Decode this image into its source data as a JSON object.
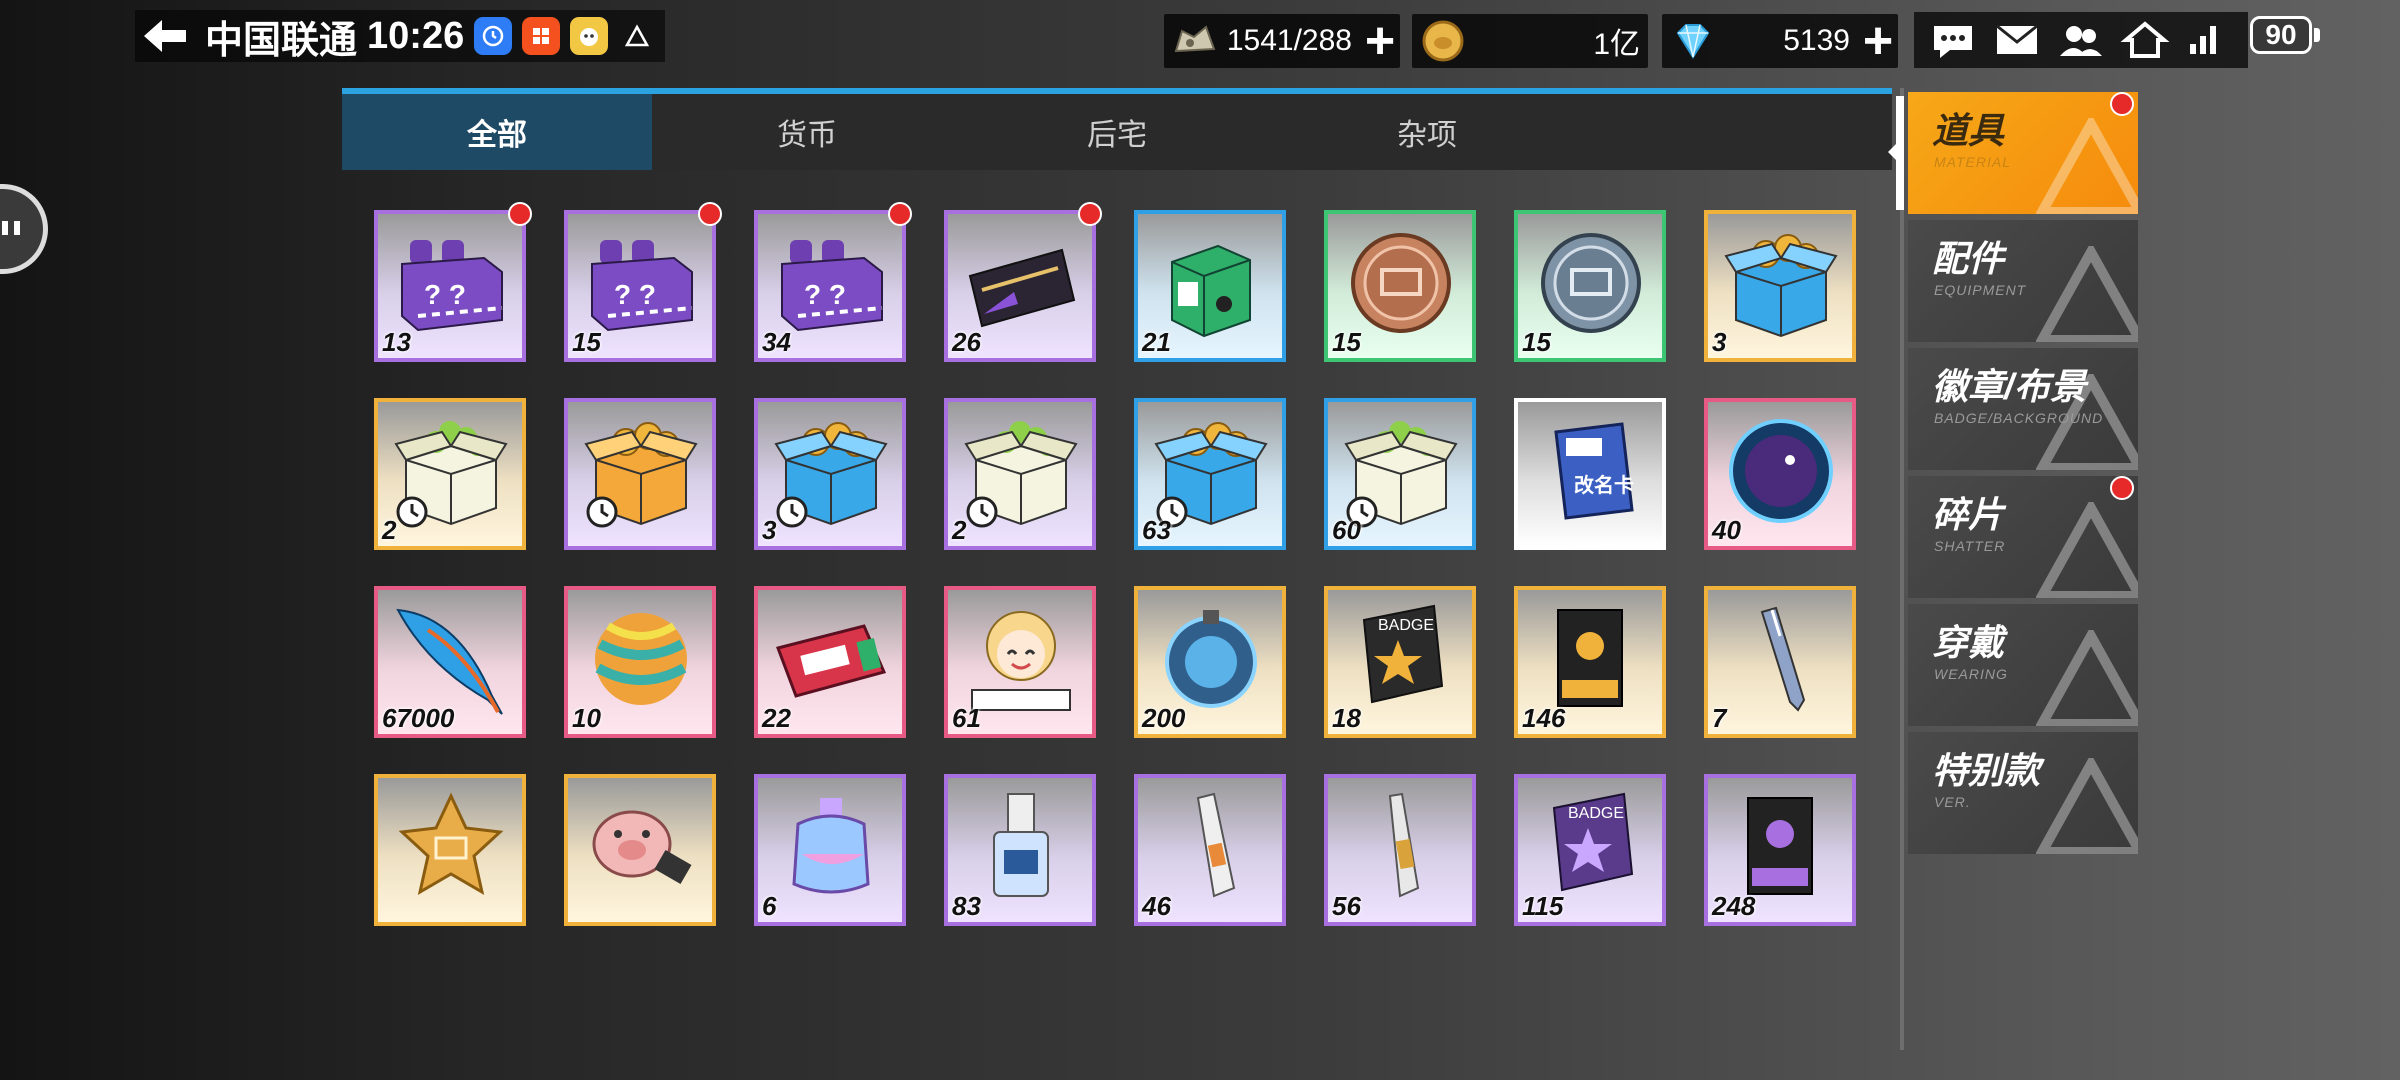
{
  "status_bar": {
    "carrier": "中国联通",
    "time": "10:26",
    "battery": "90"
  },
  "resources": {
    "stamina": "1541/288",
    "coins": "1亿",
    "gems": "5139"
  },
  "tabs": [
    {
      "label": "全部",
      "active": true
    },
    {
      "label": "货币",
      "active": false
    },
    {
      "label": "后宅",
      "active": false
    },
    {
      "label": "杂项",
      "active": false
    }
  ],
  "items": [
    {
      "count": "13",
      "rarity": "purple",
      "art": "gift-box-icon",
      "dot": true
    },
    {
      "count": "15",
      "rarity": "purple",
      "art": "gift-box-icon",
      "dot": true
    },
    {
      "count": "34",
      "rarity": "purple",
      "art": "gift-box-icon",
      "dot": true
    },
    {
      "count": "26",
      "rarity": "purple",
      "art": "ticket-icon",
      "dot": true
    },
    {
      "count": "21",
      "rarity": "blue",
      "art": "green-box-icon",
      "dot": false
    },
    {
      "count": "15",
      "rarity": "green",
      "art": "bronze-coin-icon",
      "dot": false
    },
    {
      "count": "15",
      "rarity": "green",
      "art": "silver-coin-icon",
      "dot": false
    },
    {
      "count": "3",
      "rarity": "gold",
      "art": "coin-chest-blue-icon",
      "dot": false
    },
    {
      "count": "2",
      "rarity": "gold",
      "art": "timed-clover-box-icon",
      "dot": false
    },
    {
      "count": "",
      "rarity": "purple",
      "art": "timed-coin-box-icon",
      "dot": false
    },
    {
      "count": "3",
      "rarity": "purple",
      "art": "timed-blue-box-icon",
      "dot": false
    },
    {
      "count": "2",
      "rarity": "purple",
      "art": "timed-clover-box-icon",
      "dot": false
    },
    {
      "count": "63",
      "rarity": "blue",
      "art": "timed-blue-box-icon",
      "dot": false
    },
    {
      "count": "60",
      "rarity": "blue",
      "art": "timed-clover-box-icon",
      "dot": false
    },
    {
      "count": "",
      "rarity": "white",
      "art": "rename-card-icon",
      "dot": false
    },
    {
      "count": "40",
      "rarity": "pink",
      "art": "moon-orb-icon",
      "dot": false
    },
    {
      "count": "67000",
      "rarity": "pink",
      "art": "feather-icon",
      "dot": false
    },
    {
      "count": "10",
      "rarity": "pink",
      "art": "striped-ball-icon",
      "dot": false
    },
    {
      "count": "22",
      "rarity": "pink",
      "art": "lucky-ticket-icon",
      "dot": false
    },
    {
      "count": "61",
      "rarity": "pink",
      "art": "figure-story-icon",
      "dot": false
    },
    {
      "count": "200",
      "rarity": "gold",
      "art": "blue-orb-icon",
      "dot": false
    },
    {
      "count": "18",
      "rarity": "gold",
      "art": "badge-scroll-icon",
      "dot": false
    },
    {
      "count": "146",
      "rarity": "gold",
      "art": "equipment-book-gold-icon",
      "dot": false
    },
    {
      "count": "7",
      "rarity": "gold",
      "art": "pen-icon",
      "dot": false
    },
    {
      "count": "",
      "rarity": "gold",
      "art": "star-coin-icon",
      "dot": false
    },
    {
      "count": "",
      "rarity": "gold",
      "art": "pig-usb-icon",
      "dot": false
    },
    {
      "count": "6",
      "rarity": "purple",
      "art": "perfume-bottle-icon",
      "dot": false
    },
    {
      "count": "83",
      "rarity": "purple",
      "art": "nail-polish-icon",
      "dot": false
    },
    {
      "count": "46",
      "rarity": "purple",
      "art": "tube-icon",
      "dot": false
    },
    {
      "count": "56",
      "rarity": "purple",
      "art": "glue-tube-icon",
      "dot": false
    },
    {
      "count": "115",
      "rarity": "purple",
      "art": "badge-scroll-purple-icon",
      "dot": false
    },
    {
      "count": "248",
      "rarity": "purple",
      "art": "equipment-book-purple-icon",
      "dot": false
    }
  ],
  "sidebar": [
    {
      "label": "道具",
      "sub": "MATERIAL",
      "active": true,
      "dot": true
    },
    {
      "label": "配件",
      "sub": "EQUIPMENT",
      "active": false,
      "dot": false
    },
    {
      "label": "徽章/布景",
      "sub": "BADGE/BACKGROUND",
      "active": false,
      "dot": false
    },
    {
      "label": "碎片",
      "sub": "SHATTER",
      "active": false,
      "dot": true
    },
    {
      "label": "穿戴",
      "sub": "WEARING",
      "active": false,
      "dot": false
    },
    {
      "label": "特别款",
      "sub": "VER.",
      "active": false,
      "dot": false
    }
  ]
}
